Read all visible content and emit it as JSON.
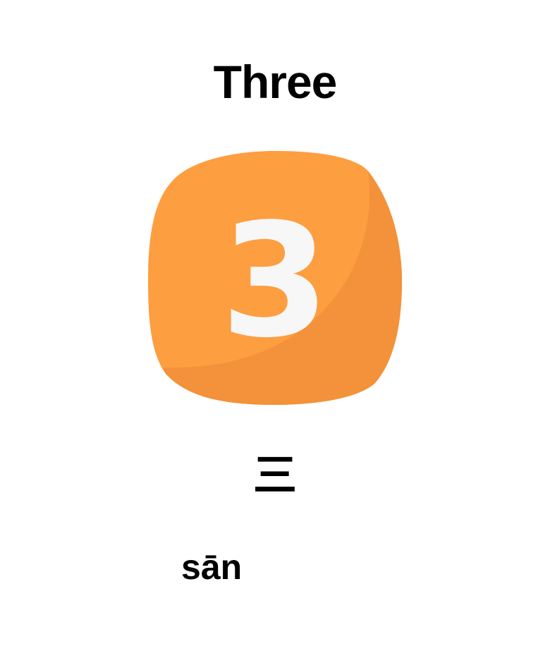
{
  "card": {
    "title": "Three",
    "numeral": "3",
    "hanzi": "三",
    "pinyin": "sān",
    "colors": {
      "badge_light": "#FD9E40",
      "badge_shade": "#F3923A",
      "numeral": "#F7F7F7"
    },
    "icon": "number-three-badge-icon"
  }
}
